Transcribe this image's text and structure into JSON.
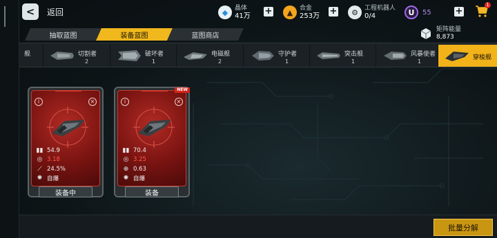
{
  "topbar": {
    "back_label": "返回",
    "resources": [
      {
        "name": "晶体",
        "value": "41万",
        "icon": "crystal-icon",
        "color": "#3aa0e0"
      },
      {
        "name": "合金",
        "value": "253万",
        "icon": "alloy-icon",
        "color": "#f0a020"
      },
      {
        "name": "工程机器人",
        "value": "0/4",
        "icon": "robot-icon",
        "color": "#d7dde0"
      }
    ],
    "premium": {
      "value": "55",
      "icon": "u-currency-icon",
      "color": "#8a4bd8"
    },
    "cart_badge": "1"
  },
  "tabs": [
    {
      "label": "抽取蓝图",
      "active": false
    },
    {
      "label": "装备蓝图",
      "active": true
    },
    {
      "label": "蓝图商店",
      "active": false
    }
  ],
  "matrix_energy": {
    "name": "矩阵能量",
    "value": "8,873"
  },
  "ship_strip": [
    {
      "name": "舰",
      "count": ""
    },
    {
      "name": "切割者",
      "count": "2"
    },
    {
      "name": "破坏者",
      "count": "1"
    },
    {
      "name": "电磁舰",
      "count": "2"
    },
    {
      "name": "守护者",
      "count": "1"
    },
    {
      "name": "突击舰",
      "count": "1"
    },
    {
      "name": "风暴使者",
      "count": "1"
    },
    {
      "name": "穿梭舰",
      "count": ""
    }
  ],
  "cards": [
    {
      "stats": {
        "a": "54.9",
        "b": "3.18",
        "c": "24.5%",
        "d": "自爆"
      },
      "footer": "装备中",
      "is_new": false
    },
    {
      "stats": {
        "a": "70.4",
        "b": "3.25",
        "c": "0.63",
        "d": "自爆"
      },
      "footer": "装备",
      "is_new": true,
      "new_label": "NEW"
    }
  ],
  "bulk_button": "批量分解",
  "colors": {
    "accent": "#f0b81c",
    "card_red": "#9e1f19"
  }
}
